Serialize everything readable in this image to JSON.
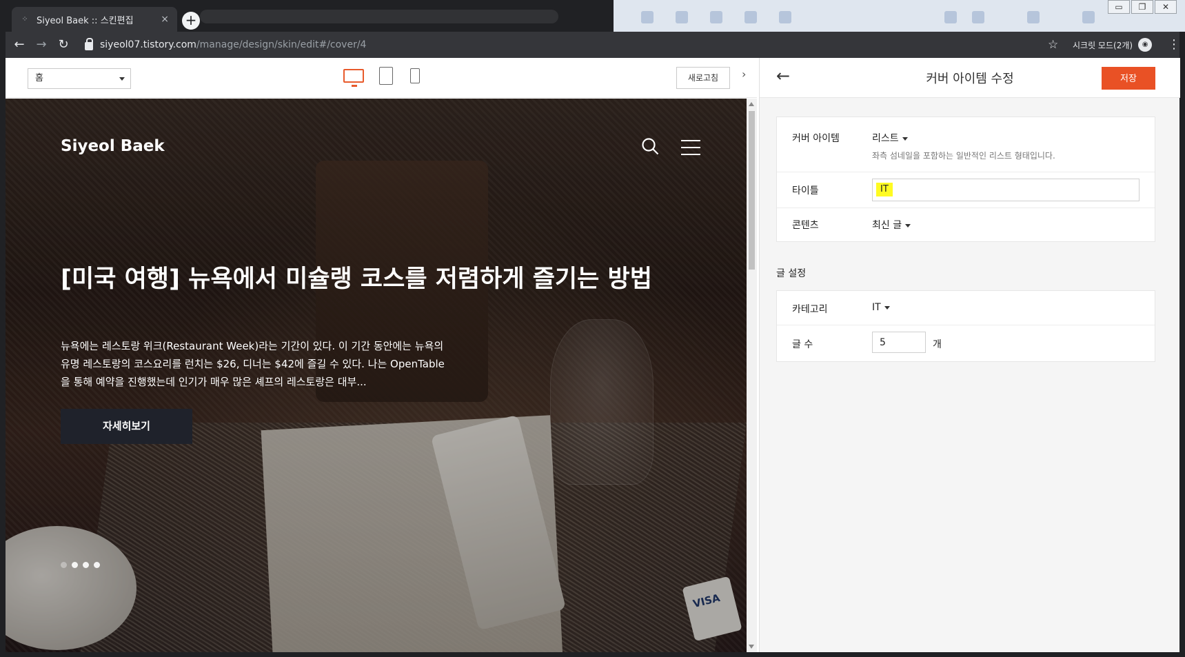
{
  "browser": {
    "tab_title": "Siyeol Baek :: 스킨편집",
    "tab_close": "×",
    "new_tab": "+",
    "url_host": "siyeol07.tistory.com",
    "url_path": "/manage/design/skin/edit#/cover/4",
    "incognito_label": "시크릿 모드(2개)",
    "win_minimize": "▭",
    "win_restore": "❐",
    "win_close": "✕"
  },
  "editor_bar": {
    "page_select": "홈",
    "refresh_label": "새로고침",
    "collapse": "›"
  },
  "preview": {
    "blog_name": "Siyeol Baek",
    "post_title": "[미국 여행] 뉴욕에서 미슐랭 코스를 저렴하게 즐기는 방법",
    "post_excerpt": "뉴욕에는 레스토랑 위크(Restaurant Week)라는 기간이 있다. 이 기간 동안에는 뉴욕의 유명 레스토랑의 코스요리를 런치는 $26, 디너는 $42에 즐길 수 있다. 나는 OpenTable을 통해 예약을 진행했는데 인기가 매우 많은 셰프의 레스토랑은 대부...",
    "more_button": "자세히보기",
    "visa": "VISA",
    "slides": 4,
    "active_slide": 2
  },
  "panel": {
    "back": "←",
    "title": "커버 아이템 수정",
    "save_label": "저장",
    "cover_item_label": "커버 아이템",
    "cover_item_value": "리스트",
    "cover_item_desc": "좌측 섬네일을 포함하는 일반적인 리스트 형태입니다.",
    "title_label": "타이틀",
    "title_value": "IT",
    "content_label": "콘텐츠",
    "content_value": "최신 글",
    "post_settings_label": "글 설정",
    "category_label": "카테고리",
    "category_value": "IT",
    "count_label": "글 수",
    "count_value": "5",
    "count_unit": "개"
  },
  "colors": {
    "accent": "#e95125",
    "active_device": "#e85a2b"
  }
}
